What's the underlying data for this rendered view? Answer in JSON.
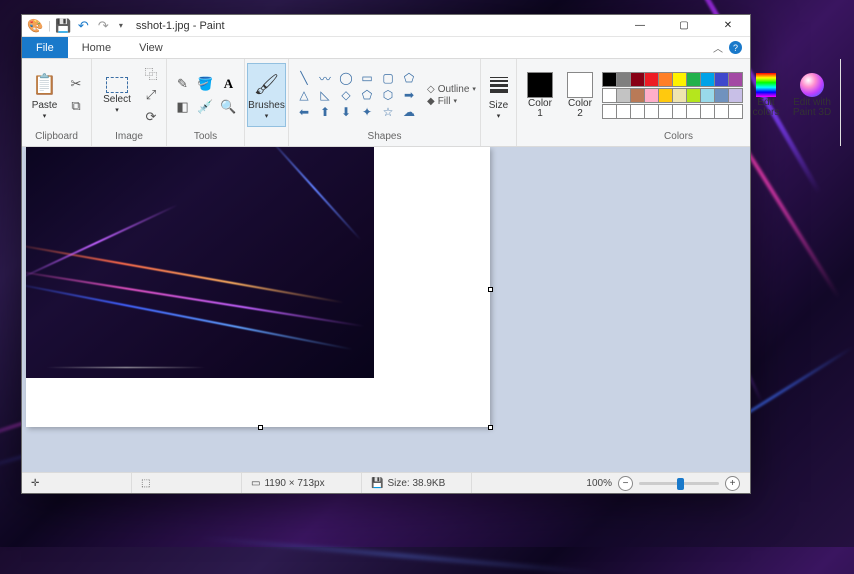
{
  "app": {
    "title": "sshot-1.jpg - Paint"
  },
  "window_controls": {
    "minimize": "—",
    "maximize": "▢",
    "close": "✕"
  },
  "qat": {
    "app_icon": "paint-app-icon",
    "save_icon": "save-icon",
    "undo_icon": "undo-icon",
    "redo_icon": "redo-icon"
  },
  "tabs": {
    "file": "File",
    "home": "Home",
    "view": "View"
  },
  "ribbon": {
    "clipboard": {
      "paste": "Paste",
      "group": "Clipboard",
      "cut_icon": "cut-icon",
      "copy_icon": "copy-icon"
    },
    "image": {
      "select": "Select",
      "group": "Image",
      "crop_icon": "crop-icon",
      "resize_icon": "resize-icon",
      "rotate_icon": "rotate-icon"
    },
    "tools": {
      "group": "Tools",
      "items": [
        "pencil-icon",
        "fill-icon",
        "text-icon",
        "eraser-icon",
        "picker-icon",
        "magnifier-icon"
      ]
    },
    "brushes": {
      "label": "Brushes"
    },
    "shapes": {
      "group": "Shapes",
      "outline": "Outline",
      "fill": "Fill",
      "items": [
        "line",
        "curve",
        "oval",
        "rect",
        "rrect",
        "polygon",
        "triangle",
        "rtri",
        "diamond",
        "pent",
        "hex",
        "rarrow",
        "larrow",
        "uarrow",
        "darrow",
        "star4",
        "star5",
        "star6"
      ]
    },
    "size": {
      "label": "Size"
    },
    "colors_group": "Colors",
    "color1": {
      "label": "Color\n1",
      "hex": "#000000"
    },
    "color2": {
      "label": "Color\n2",
      "hex": "#ffffff"
    },
    "palette": {
      "row1": [
        "#000000",
        "#7f7f7f",
        "#880015",
        "#ed1c24",
        "#ff7f27",
        "#fff200",
        "#22b14c",
        "#00a2e8",
        "#3f48cc",
        "#a349a4"
      ],
      "row2": [
        "#ffffff",
        "#c3c3c3",
        "#b97a57",
        "#ffaec9",
        "#ffc90e",
        "#efe4b0",
        "#b5e61d",
        "#99d9ea",
        "#7092be",
        "#c8bfe7"
      ],
      "row3": [
        "#ffffff",
        "#ffffff",
        "#ffffff",
        "#ffffff",
        "#ffffff",
        "#ffffff",
        "#ffffff",
        "#ffffff",
        "#ffffff",
        "#ffffff"
      ]
    },
    "edit_colors": "Edit\ncolors",
    "paint3d": "Edit with\nPaint 3D"
  },
  "status": {
    "dimensions": "1190 × 713px",
    "size_label": "Size: 38.9KB",
    "zoom": "100%"
  }
}
